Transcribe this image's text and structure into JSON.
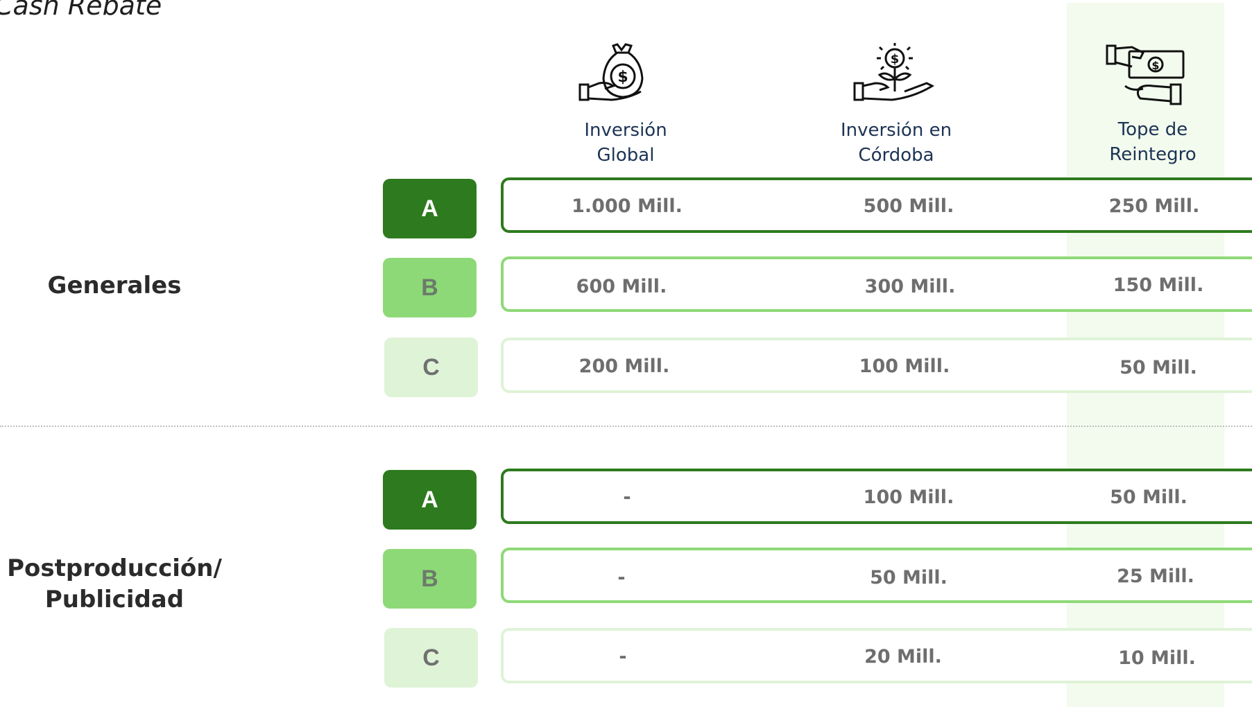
{
  "title": "Cash Rebate",
  "columns": [
    {
      "label_line1": "Inversión",
      "label_line2": "Global",
      "icon": "money-bag-in-hand-icon"
    },
    {
      "label_line1": "Inversión en",
      "label_line2": "Córdoba",
      "icon": "plant-growing-coin-in-hand-icon"
    },
    {
      "label_line1": "Tope de",
      "label_line2": "Reintegro",
      "icon": "cash-to-hand-icon"
    }
  ],
  "groups": [
    {
      "label": "Generales",
      "rows": [
        {
          "category": "A",
          "global": "1.000 Mill.",
          "cordoba": "500 Mill.",
          "tope": "250 Mill."
        },
        {
          "category": "B",
          "global": "600 Mill.",
          "cordoba": "300 Mill.",
          "tope": "150 Mill."
        },
        {
          "category": "C",
          "global": "200 Mill.",
          "cordoba": "100 Mill.",
          "tope": "50 Mill."
        }
      ]
    },
    {
      "label_line1": "Postproducción/",
      "label_line2": "Publicidad",
      "rows": [
        {
          "category": "A",
          "global": "-",
          "cordoba": "100 Mill.",
          "tope": "50 Mill."
        },
        {
          "category": "B",
          "global": "-",
          "cordoba": "50 Mill.",
          "tope": "25 Mill."
        },
        {
          "category": "C",
          "global": "-",
          "cordoba": "20 Mill.",
          "tope": "10 Mill."
        }
      ]
    }
  ],
  "colors": {
    "category_a": "#2e7a1e",
    "category_b": "#8ed977",
    "category_c": "#dff3d7",
    "highlight_column": "#f2fbee",
    "header_text": "#1c3354"
  }
}
